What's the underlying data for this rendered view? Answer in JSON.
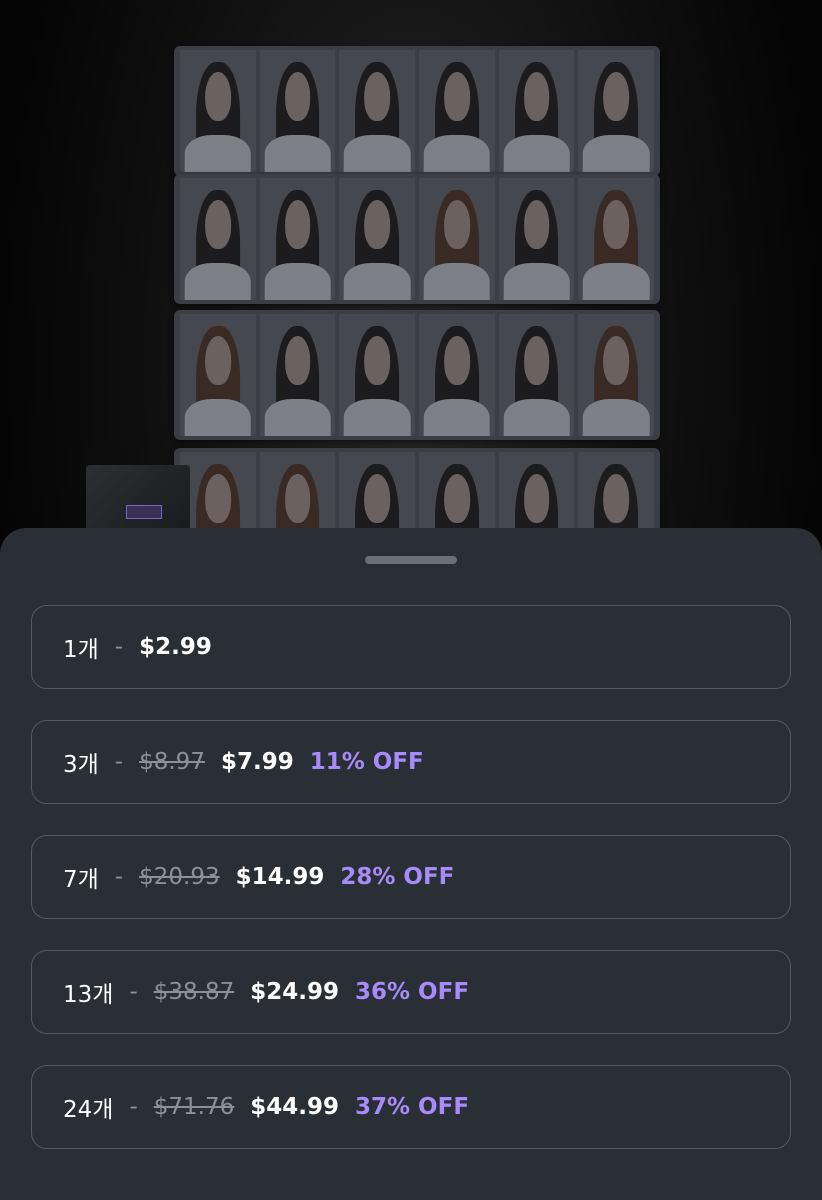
{
  "product": {
    "sheet_count": 4,
    "cards_per_sheet": 6
  },
  "options": [
    {
      "quantity": "1개",
      "separator": "-",
      "original_price": "",
      "price": "$2.99",
      "discount": ""
    },
    {
      "quantity": "3개",
      "separator": "-",
      "original_price": "$8.97",
      "price": "$7.99",
      "discount": "11% OFF"
    },
    {
      "quantity": "7개",
      "separator": "-",
      "original_price": "$20.93",
      "price": "$14.99",
      "discount": "28% OFF"
    },
    {
      "quantity": "13개",
      "separator": "-",
      "original_price": "$38.87",
      "price": "$24.99",
      "discount": "36% OFF"
    },
    {
      "quantity": "24개",
      "separator": "-",
      "original_price": "$71.76",
      "price": "$44.99",
      "discount": "37% OFF"
    }
  ],
  "colors": {
    "sheet_background": "#2a2e35",
    "option_border": "#555a62",
    "discount_accent": "#a78bfa",
    "muted_text": "#8c9097"
  }
}
